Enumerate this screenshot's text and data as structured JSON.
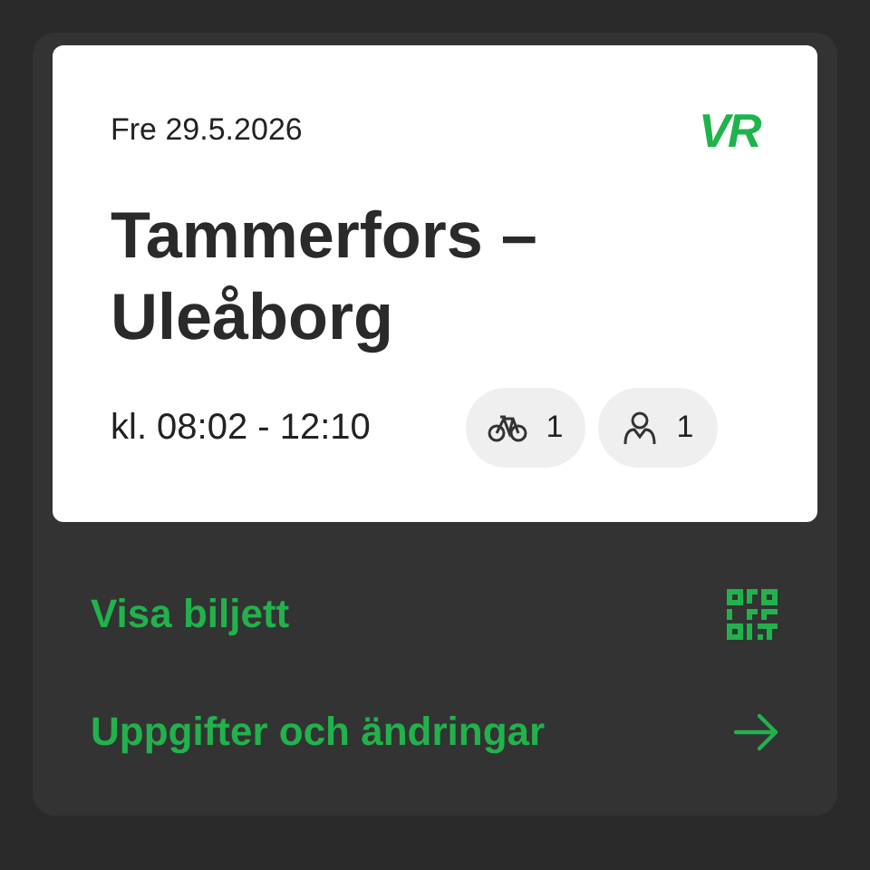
{
  "ticket": {
    "date": "Fre 29.5.2026",
    "logo": "VR",
    "route": "Tammerfors – Uleåborg",
    "time": "kl. 08:02 - 12:10",
    "chips": [
      {
        "kind": "bike",
        "count": "1"
      },
      {
        "kind": "passenger",
        "count": "1"
      }
    ]
  },
  "actions": [
    {
      "kind": "qr",
      "label": "Visa biljett"
    },
    {
      "kind": "arrow",
      "label": "Uppgifter och ändringar"
    }
  ]
}
